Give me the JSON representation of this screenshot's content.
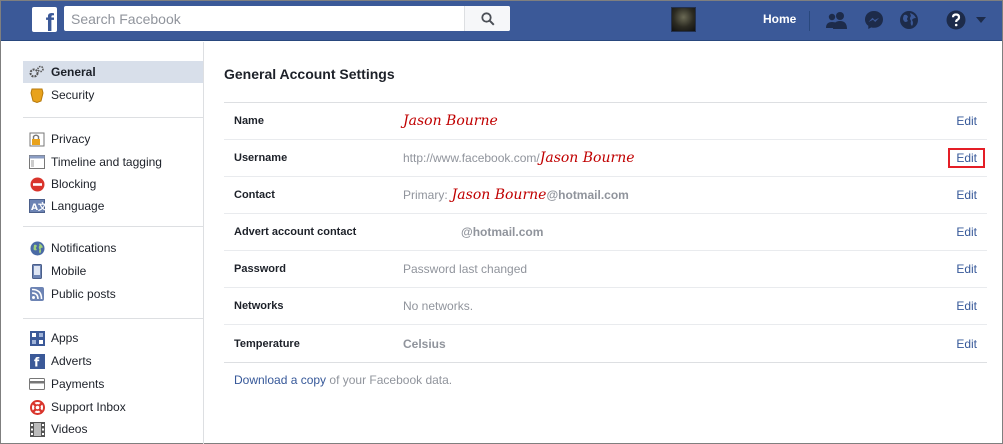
{
  "topbar": {
    "logo": "f",
    "search_placeholder": "Search Facebook",
    "home_label": "Home",
    "colors": {
      "bar": "#3b5998",
      "link": "#365899",
      "highlight": "#e41e26"
    }
  },
  "sidebar": {
    "groups": [
      [
        {
          "label": "General",
          "icon": "gears-icon",
          "active": true
        },
        {
          "label": "Security",
          "icon": "badge-icon",
          "active": false
        }
      ],
      [
        {
          "label": "Privacy",
          "icon": "lock-icon",
          "active": false
        },
        {
          "label": "Timeline and tagging",
          "icon": "timeline-icon",
          "active": false
        },
        {
          "label": "Blocking",
          "icon": "block-icon",
          "active": false
        },
        {
          "label": "Language",
          "icon": "language-icon",
          "active": false
        }
      ],
      [
        {
          "label": "Notifications",
          "icon": "globe-icon",
          "active": false
        },
        {
          "label": "Mobile",
          "icon": "mobile-icon",
          "active": false
        },
        {
          "label": "Public posts",
          "icon": "rss-icon",
          "active": false
        }
      ],
      [
        {
          "label": "Apps",
          "icon": "apps-icon",
          "active": false
        },
        {
          "label": "Adverts",
          "icon": "adverts-icon",
          "active": false
        },
        {
          "label": "Payments",
          "icon": "card-icon",
          "active": false
        },
        {
          "label": "Support Inbox",
          "icon": "lifebuoy-icon",
          "active": false
        },
        {
          "label": "Videos",
          "icon": "film-icon",
          "active": false
        }
      ]
    ]
  },
  "main": {
    "title": "General Account Settings",
    "rows": [
      {
        "label": "Name",
        "prefix": "",
        "hand": "Jason Bourne",
        "suffix": "",
        "edit": "Edit"
      },
      {
        "label": "Username",
        "prefix": "http://www.facebook.com/",
        "hand": "Jason Bourne",
        "suffix": "",
        "edit": "Edit"
      },
      {
        "label": "Contact",
        "prefix": "Primary: ",
        "hand": "Jason Bourne",
        "suffix": "@hotmail.com",
        "edit": "Edit"
      },
      {
        "label": "Advert account contact",
        "prefix": "",
        "hand": "",
        "suffix": "@hotmail.com",
        "edit": "Edit"
      },
      {
        "label": "Password",
        "prefix": "Password last changed",
        "hand": "",
        "suffix": "",
        "edit": "Edit"
      },
      {
        "label": "Networks",
        "prefix": "No networks.",
        "hand": "",
        "suffix": "",
        "edit": "Edit"
      },
      {
        "label": "Temperature",
        "prefix": "",
        "hand": "",
        "suffix": "Celsius",
        "edit": "Edit"
      }
    ],
    "download": {
      "link": "Download a copy",
      "rest": " of your Facebook data."
    }
  }
}
